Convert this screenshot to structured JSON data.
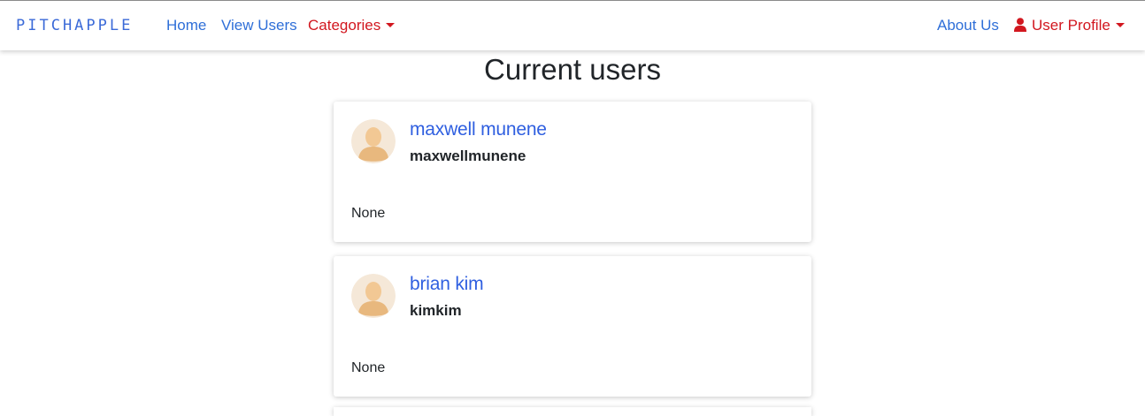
{
  "navbar": {
    "brand": "PITCHAPPLE",
    "links": {
      "home": "Home",
      "view_users": "View Users",
      "categories": "Categories",
      "about_us": "About Us",
      "user_profile": "User Profile"
    }
  },
  "page": {
    "title": "Current users"
  },
  "users": [
    {
      "name": "maxwell munene",
      "username": "maxwellmunene",
      "bio": "None"
    },
    {
      "name": "brian kim",
      "username": "kimkim",
      "bio": "None"
    }
  ],
  "colors": {
    "link_blue": "#2f6fd8",
    "dropdown_red": "#d2171f",
    "name_blue": "#2f5fe0"
  },
  "icons": {
    "user": "user-icon",
    "caret": "caret-down-icon"
  }
}
